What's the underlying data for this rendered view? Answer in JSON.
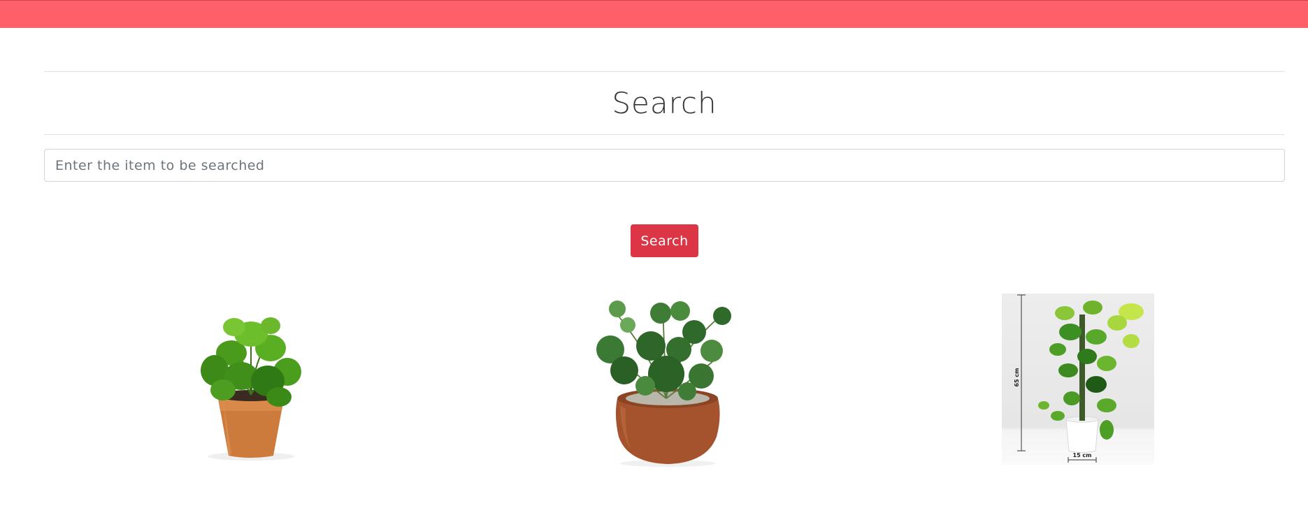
{
  "header": {
    "color": "#ff5f69"
  },
  "search": {
    "title": "Search",
    "placeholder": "Enter the item to be searched",
    "value": "",
    "button_label": "Search",
    "button_color": "#dc3545"
  },
  "products": [
    {
      "image": "plant-terracotta-pot-image"
    },
    {
      "image": "plant-round-clay-pot-image"
    },
    {
      "image": "money-plant-moss-stick-image",
      "height_label": "65 cm",
      "width_label": "15 cm"
    }
  ]
}
